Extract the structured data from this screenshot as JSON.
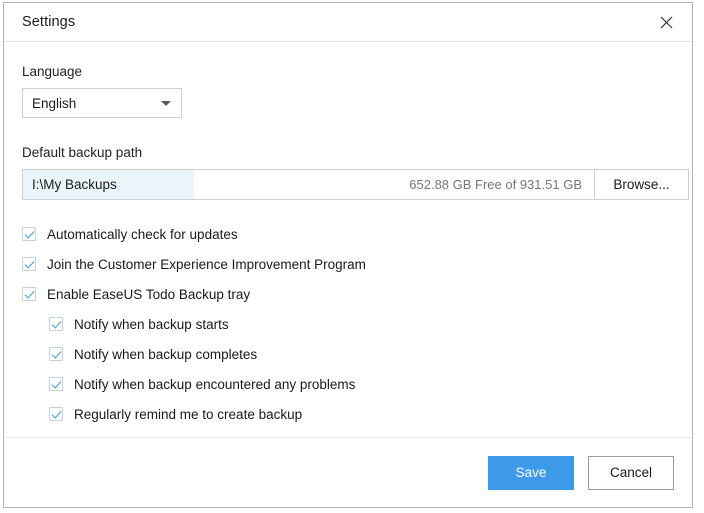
{
  "window": {
    "title": "Settings",
    "close_icon": "close-icon"
  },
  "language": {
    "label": "Language",
    "selected": "English",
    "dropdown_icon": "chevron-down-icon"
  },
  "backup_path": {
    "label": "Default backup path",
    "value": "I:\\My Backups",
    "space_text": "652.88 GB Free of 931.51 GB",
    "browse_label": "Browse...",
    "used_percent": 29.9
  },
  "options": [
    {
      "label": "Automatically check for updates",
      "checked": true,
      "sub": false
    },
    {
      "label": "Join the Customer Experience Improvement Program",
      "checked": true,
      "sub": false
    },
    {
      "label": "Enable EaseUS Todo Backup tray",
      "checked": true,
      "sub": false
    },
    {
      "label": "Notify when backup starts",
      "checked": true,
      "sub": true
    },
    {
      "label": "Notify when backup completes",
      "checked": true,
      "sub": true
    },
    {
      "label": "Notify when backup encountered any problems",
      "checked": true,
      "sub": true
    },
    {
      "label": "Regularly remind me to create backup",
      "checked": true,
      "sub": true
    }
  ],
  "footer": {
    "save_label": "Save",
    "cancel_label": "Cancel"
  },
  "colors": {
    "accent": "#3d9ae8",
    "fill": "#eaf4fb",
    "border": "#cfcfcf"
  }
}
